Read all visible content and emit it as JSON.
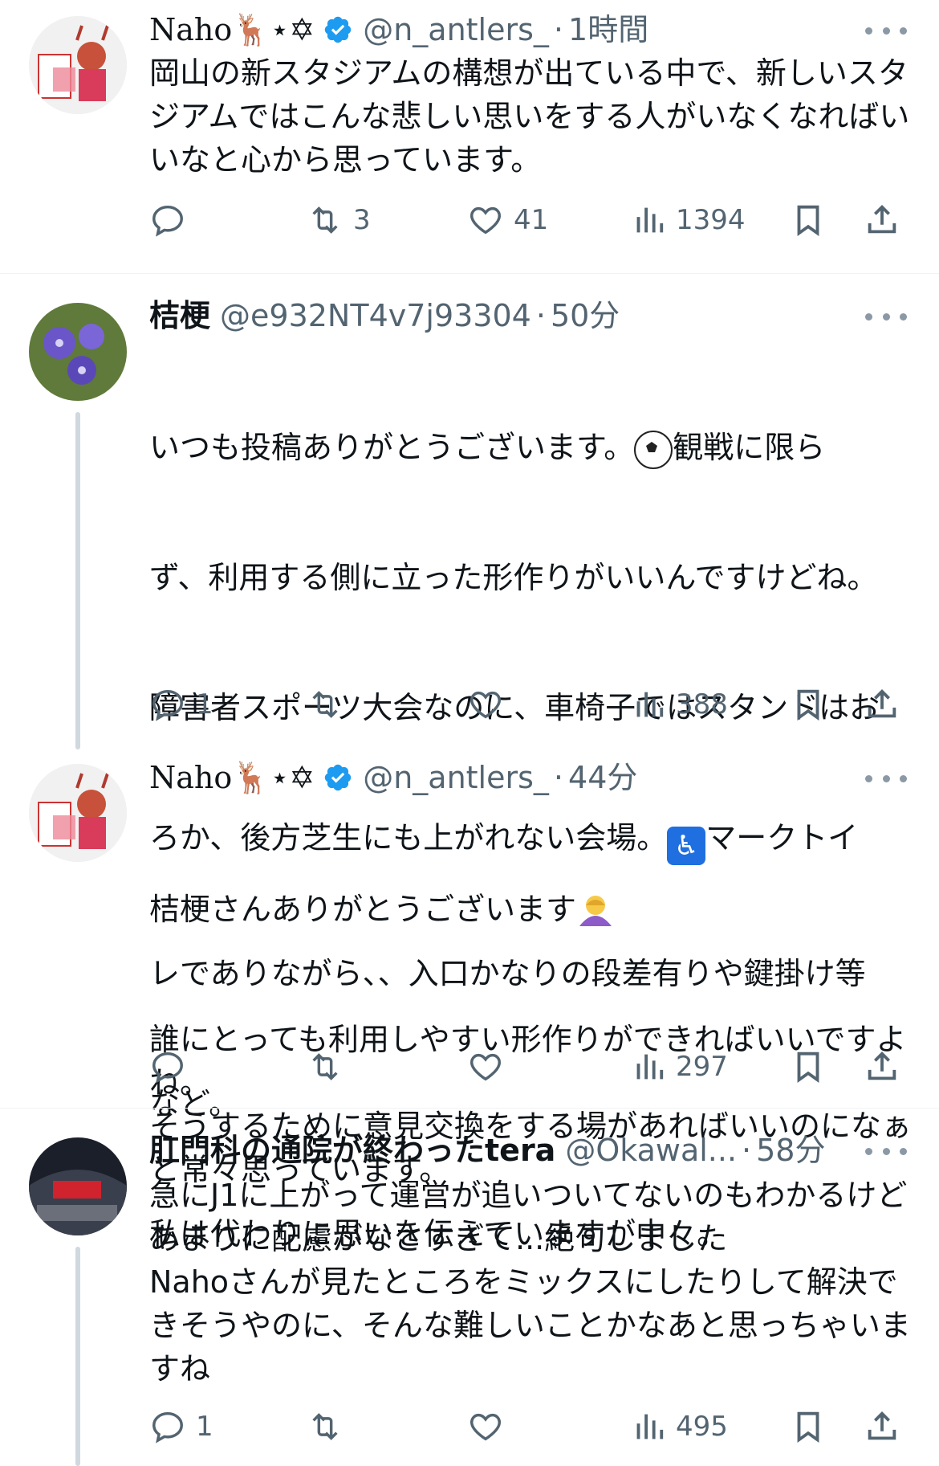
{
  "tweets": [
    {
      "name": "Naho🦌⋆✡",
      "verified": true,
      "handle": "@n_antlers_",
      "sep": "·",
      "time": "1時間",
      "text": "岡山の新スタジアムの構想が出ている中で、新しいスタジアムではこんな悲しい思いをする人がいなくなればいいなと心から思っています。",
      "replies": "",
      "retweets": "3",
      "likes": "41",
      "views": "1394"
    },
    {
      "name": "桔梗",
      "verified": false,
      "handle": "@e932NT4v7j93304",
      "sep": "·",
      "time": "50分",
      "text_lines": [
        "いつも投稿ありがとうございます。",
        "観戦に限ら",
        "ず、利用する側に立った形作りがいいんですけどね。",
        "障害者スポーツ大会なのに、車椅子ではスタンドはお",
        "ろか、後方芝生にも上がれない会場。",
        "マークトイ",
        "レでありながら、、入口かなりの段差有りや鍵掛け等",
        "など。",
        "私は代わりに思いを伝えていますが中々。"
      ],
      "replies": "1",
      "retweets": "",
      "likes": "",
      "views": "388"
    },
    {
      "name": "Naho🦌⋆✡",
      "verified": true,
      "handle": "@n_antlers_",
      "sep": "·",
      "time": "44分",
      "text_first": "桔梗さんありがとうございます",
      "text_rest": "誰にとっても利用しやすい形作りができればいいですよね。\nそうするために意見交換をする場があればいいのになぁと常々思っています。",
      "replies": "",
      "retweets": "",
      "likes": "",
      "views": "297"
    },
    {
      "name": "肛門科の通院が終わったtera",
      "verified": false,
      "handle": "@Okawal...",
      "sep": "·",
      "time": "58分",
      "text": "急にJ1に上がって運営が追いついてないのもわかるけどあまりに配慮がなさすぎて...絶句しました\nNahoさんが見たところをミックスにしたりして解決できそうやのに、そんな難しいことかなあと思っちゃいますね",
      "replies": "1",
      "retweets": "",
      "likes": "",
      "views": "495"
    }
  ],
  "icons": {
    "reply": "reply-icon",
    "retweet": "retweet-icon",
    "like": "heart-icon",
    "views": "views-icon",
    "bookmark": "bookmark-icon",
    "share": "share-icon",
    "more": "more-icon",
    "verified": "verified-badge-icon"
  },
  "colors": {
    "verified": "#1d9bf0",
    "muted": "#536471",
    "text": "#0f1419"
  }
}
